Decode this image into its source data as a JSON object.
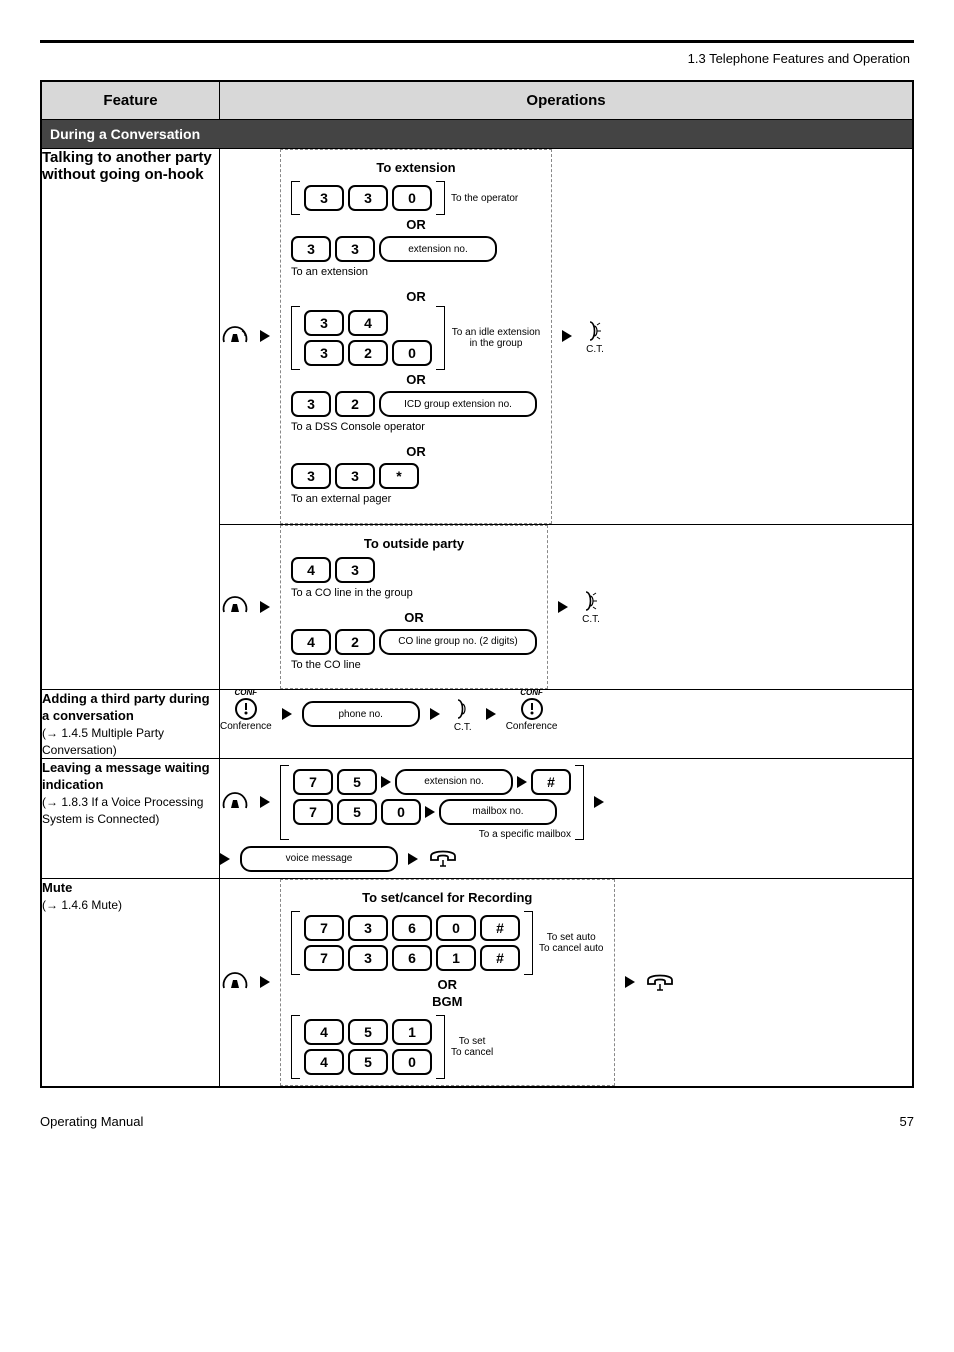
{
  "chapter": "1.3 Telephone Features and Operation",
  "table": {
    "col_feature": "Feature",
    "col_operations": "Operations"
  },
  "section_header": "During a Conversation",
  "rows": {
    "ext_talk": {
      "title": "Talking to another party without going on-hook",
      "group_ext": "To extension",
      "opts": {
        "a_label": "To the operator",
        "b_slot": "extension no.",
        "b_label": "To an extension",
        "c1_label": "To an idle extension in the group",
        "c_slot": "ICD group extension no.",
        "d_label": "To a DSS Console operator",
        "e_label": "To an external pager"
      },
      "keys": {
        "3": "3",
        "0": "0",
        "4": "4",
        "2": "2",
        "star": "*"
      },
      "ct": "C.T."
    },
    "out_talk": {
      "group_out": "To outside party",
      "opts": {
        "a_label": "To a CO line in the group",
        "b_slot": "CO line group no. (2 digits)",
        "b_label": "To the CO line"
      },
      "keys": {
        "4": "4",
        "3": "3",
        "2": "2"
      },
      "ct": "C.T."
    },
    "conf": {
      "title": "Adding a third party during a conversation",
      "conference": "Conference",
      "ref": "(→ 1.4.5 Multiple Party Conversation)",
      "slot": "phone no.",
      "ct": "C.T."
    },
    "voice": {
      "title": "Leaving a message waiting indication",
      "ref": "(→ 1.8.3 If a Voice Processing System is Connected)",
      "slots": {
        "ext": "extension no.",
        "mailbox": "mailbox no.",
        "msg": "voice message"
      },
      "sub_label": "To a specific mailbox",
      "keys": {
        "7": "7",
        "5": "5",
        "0": "0",
        "hash": "#"
      }
    },
    "mute": {
      "title": "Mute",
      "ref": "(→ 1.4.6 Mute)",
      "group_rec": "To set/cancel for Recording",
      "opts": {
        "a_label": "To set auto",
        "b_label": "To cancel auto"
      },
      "group_bgm": "BGM",
      "bgm_a": "To set",
      "bgm_b": "To cancel",
      "keys": {
        "7": "7",
        "3": "3",
        "6": "6",
        "0": "0",
        "1": "1",
        "hash": "#",
        "4": "4",
        "5": "5"
      }
    }
  },
  "footer": {
    "left": "Operating Manual",
    "right": "57"
  }
}
